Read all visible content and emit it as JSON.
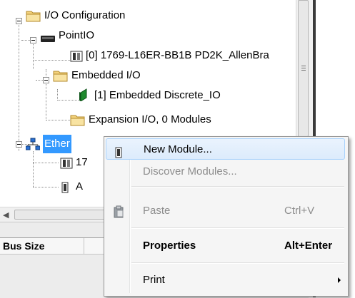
{
  "tree": {
    "items": [
      {
        "label": "I/O Configuration",
        "icon": "folder-icon"
      },
      {
        "label": "PointIO",
        "icon": "backplane-icon"
      },
      {
        "label": "[0] 1769-L16ER-BB1B PD2K_AllenBra",
        "icon": "controller-module-icon"
      },
      {
        "label": "Embedded I/O",
        "icon": "folder-icon"
      },
      {
        "label": "[1] Embedded Discrete_IO",
        "icon": "io-module-icon"
      },
      {
        "label": "Expansion I/O, 0 Modules",
        "icon": "folder-icon"
      },
      {
        "label": "Ether",
        "icon": "ethernet-network-icon"
      },
      {
        "label": "17",
        "icon": "controller-module-icon"
      },
      {
        "label": "A",
        "icon": "device-module-icon"
      }
    ]
  },
  "grid": {
    "columns": [
      "Bus Size",
      ""
    ]
  },
  "context_menu": {
    "items": [
      {
        "label": "New Module...",
        "shortcut": "",
        "icon": "module-icon",
        "state": "highlighted"
      },
      {
        "label": "Discover Modules...",
        "shortcut": "",
        "icon": "",
        "state": "disabled"
      },
      {
        "label": "Paste",
        "shortcut": "Ctrl+V",
        "icon": "clipboard-icon",
        "state": "disabled"
      },
      {
        "label": "Properties",
        "shortcut": "Alt+Enter",
        "icon": "",
        "state": "bold"
      },
      {
        "label": "Print",
        "shortcut": "",
        "icon": "",
        "state": "submenu"
      }
    ]
  },
  "colors": {
    "selection": "#3399ff",
    "menu_hover": "#dcebfc",
    "folder": "#e8c466"
  }
}
